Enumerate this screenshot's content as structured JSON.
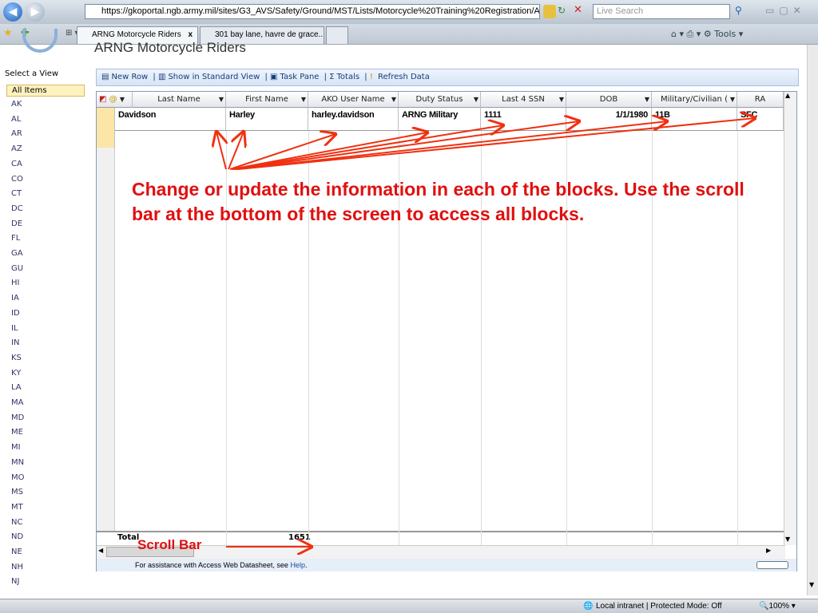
{
  "browser": {
    "url": "https://gkoportal.ngb.army.mil/sites/G3_AVS/Safety/Ground/MST/Lists/Motorcycle%20Training%20Registration/AllItems.aspx?Show",
    "search_placeholder": "Live Search",
    "tabs": [
      "ARNG Motorcycle Riders",
      "301 bay lane, havre de grace..."
    ],
    "tools_label": "Tools",
    "status": "Local intranet | Protected Mode: Off",
    "zoom": "100%"
  },
  "page": {
    "title": "ARNG Motorcycle Riders"
  },
  "sidebar": {
    "header": "Select a View",
    "selected": "All Items",
    "items": [
      "AK",
      "AL",
      "AR",
      "AZ",
      "CA",
      "CO",
      "CT",
      "DC",
      "DE",
      "FL",
      "GA",
      "GU",
      "HI",
      "IA",
      "ID",
      "IL",
      "IN",
      "KS",
      "KY",
      "LA",
      "MA",
      "MD",
      "ME",
      "MI",
      "MN",
      "MO",
      "MS",
      "MT",
      "NC",
      "ND",
      "NE",
      "NH",
      "NJ"
    ]
  },
  "toolbar": {
    "new_row": "New Row",
    "standard_view": "Show in Standard View",
    "task_pane": "Task Pane",
    "totals": "Totals",
    "refresh": "Refresh Data"
  },
  "grid": {
    "columns": [
      "Last Name",
      "First Name",
      "AKO User Name",
      "Duty Status",
      "Last 4 SSN",
      "DOB",
      "Military/Civilian (",
      "RA"
    ],
    "row": [
      "Davidson",
      "Harley",
      "harley.davidson",
      "ARNG Military",
      "1111",
      "1/1/1980",
      "11B",
      "SFC"
    ],
    "total_label": "Total",
    "total_value": "1651",
    "footer_text": "For assistance with Access Web Datasheet, see ",
    "footer_link": "Help",
    "footer_end": "."
  },
  "annotations": {
    "main": "Change or update the information in each of the blocks.  Use the scroll bar at the bottom of the screen to access all blocks.",
    "scroll": "Scroll Bar"
  }
}
